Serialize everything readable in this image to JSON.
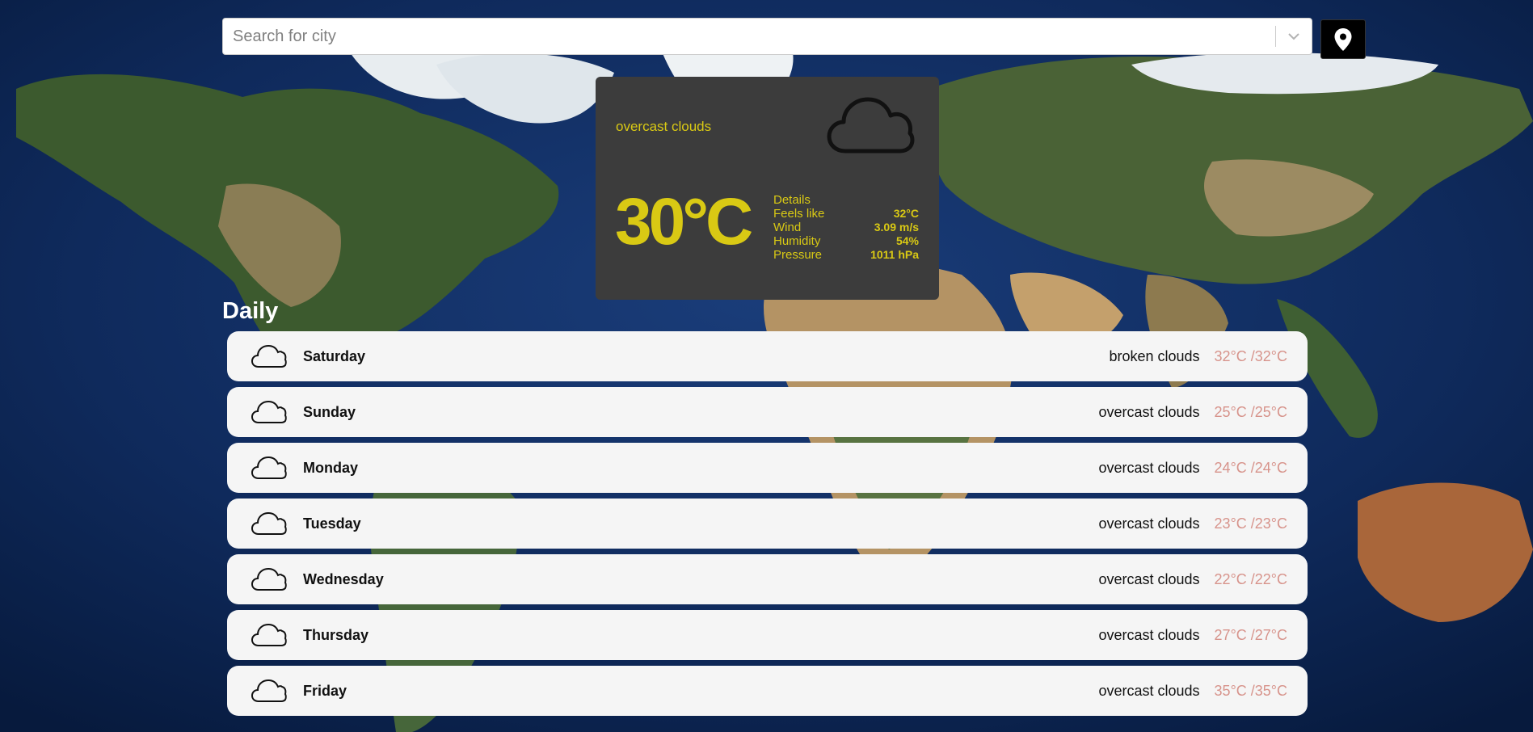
{
  "search": {
    "placeholder": "Search for city"
  },
  "current": {
    "description": "overcast clouds",
    "temperature": "30°C",
    "details_title": "Details",
    "details": [
      {
        "label": "Feels like",
        "value": "32°C"
      },
      {
        "label": "Wind",
        "value": "3.09 m/s"
      },
      {
        "label": "Humidity",
        "value": "54%"
      },
      {
        "label": "Pressure",
        "value": "1011 hPa"
      }
    ]
  },
  "daily": {
    "title": "Daily",
    "days": [
      {
        "day": "Saturday",
        "description": "broken clouds",
        "temp": "32°C /32°C"
      },
      {
        "day": "Sunday",
        "description": "overcast clouds",
        "temp": "25°C /25°C"
      },
      {
        "day": "Monday",
        "description": "overcast clouds",
        "temp": "24°C /24°C"
      },
      {
        "day": "Tuesday",
        "description": "overcast clouds",
        "temp": "23°C /23°C"
      },
      {
        "day": "Wednesday",
        "description": "overcast clouds",
        "temp": "22°C /22°C"
      },
      {
        "day": "Thursday",
        "description": "overcast clouds",
        "temp": "27°C /27°C"
      },
      {
        "day": "Friday",
        "description": "overcast clouds",
        "temp": "35°C /35°C"
      }
    ]
  },
  "colors": {
    "accent": "#d9c914",
    "card_bg": "#3c3c3c",
    "row_bg": "#f5f5f5",
    "temp_range": "#d7938b"
  },
  "icons": {
    "current": "cloud-icon",
    "location": "map-pin-icon",
    "dropdown": "chevron-down-icon",
    "day": "cloud-icon"
  }
}
